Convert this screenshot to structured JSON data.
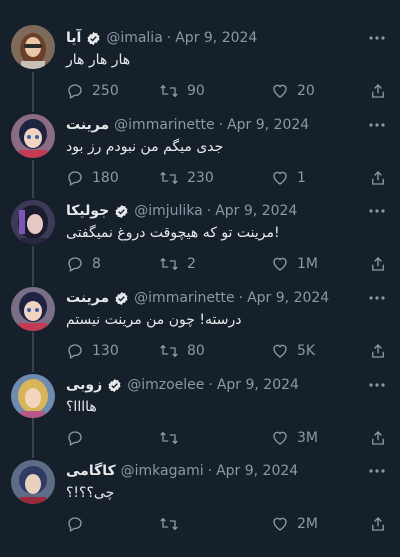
{
  "tweets": [
    {
      "name": "آیا",
      "verified": true,
      "handle": "@imalia",
      "date": "Apr 9, 2024",
      "text": "هار هار هار",
      "replies": "250",
      "retweets": "90",
      "likes": "20",
      "avatar_colors": {
        "bg": "#7e6a5a",
        "hair": "#6b3f2a",
        "skin": "#e9c7a8",
        "accent": "#2d2a2a"
      }
    },
    {
      "name": "مرینت",
      "verified": false,
      "handle": "@immarinette",
      "date": "Apr 9, 2024",
      "text": "جدی میگم من نبودم رز بود",
      "replies": "180",
      "retweets": "230",
      "likes": "1",
      "avatar_colors": {
        "bg": "#8a6d83",
        "hair": "#1e2340",
        "skin": "#f1d3c2",
        "accent": "#c43a52"
      }
    },
    {
      "name": "جولیکا",
      "verified": true,
      "handle": "@imjulika",
      "date": "Apr 9, 2024",
      "text": "!مرینت تو که هیچوقت دروغ نمیگفتی",
      "replies": "8",
      "retweets": "2",
      "likes": "1M",
      "avatar_colors": {
        "bg": "#3c3a58",
        "hair": "#1c1b2c",
        "skin": "#e3c8c4",
        "accent": "#7b55b8"
      }
    },
    {
      "name": "مرینت",
      "verified": true,
      "handle": "@immarinette",
      "date": "Apr 9, 2024",
      "text": "درسته! چون من مرینت نیستم",
      "replies": "130",
      "retweets": "80",
      "likes": "5K",
      "avatar_colors": {
        "bg": "#7a6f86",
        "hair": "#1e2340",
        "skin": "#f1d3c2",
        "accent": "#c43a52"
      }
    },
    {
      "name": "زوبی",
      "verified": true,
      "handle": "@imzoelee",
      "date": "Apr 9, 2024",
      "text": "هاااا؟",
      "replies": "",
      "retweets": "",
      "likes": "3M",
      "avatar_colors": {
        "bg": "#6e8bb0",
        "hair": "#d9b45a",
        "skin": "#f2d4bf",
        "accent": "#b6578a"
      }
    },
    {
      "name": "کاگامی",
      "verified": false,
      "handle": "@imkagami",
      "date": "Apr 9, 2024",
      "text": "چی؟؟!؟",
      "replies": "",
      "retweets": "",
      "likes": "2M",
      "avatar_colors": {
        "bg": "#5d6d86",
        "hair": "#2f3a66",
        "skin": "#ead0bf",
        "accent": "#9a2b3a"
      }
    }
  ],
  "colors": {
    "background": "#15202b",
    "text": "#e7e9ea",
    "muted": "#8b98a5",
    "thread_line": "#38444d"
  }
}
